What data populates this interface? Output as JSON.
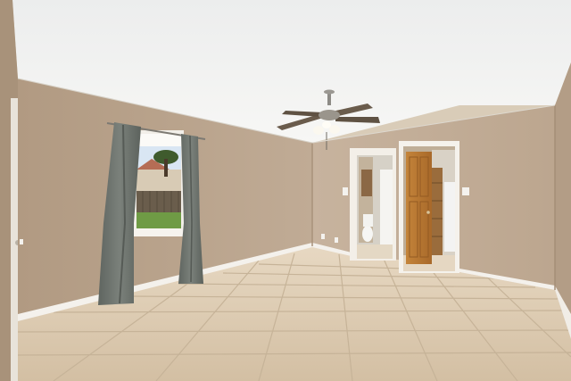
{
  "scene": {
    "subject": "empty-room-photo",
    "objects": [
      "ceiling",
      "ceiling-fan",
      "window",
      "curtains",
      "open-doorway-bathroom",
      "open-wooden-door",
      "tile-floor",
      "baseboards",
      "outlets",
      "light-switches"
    ]
  },
  "colors": {
    "ceiling": "#f3f3f1",
    "wall_left": "#b9a38c",
    "wall_back": "#c2ad97",
    "wall_right": "#bba690",
    "floor": "#dccbb2",
    "grout": "#c9b69c",
    "baseboard": "#f4f1ec",
    "curtain": "#6f7570",
    "door_wood": "#b8782f",
    "window_sky": "#d9e6f3",
    "grass": "#6f9b45"
  }
}
